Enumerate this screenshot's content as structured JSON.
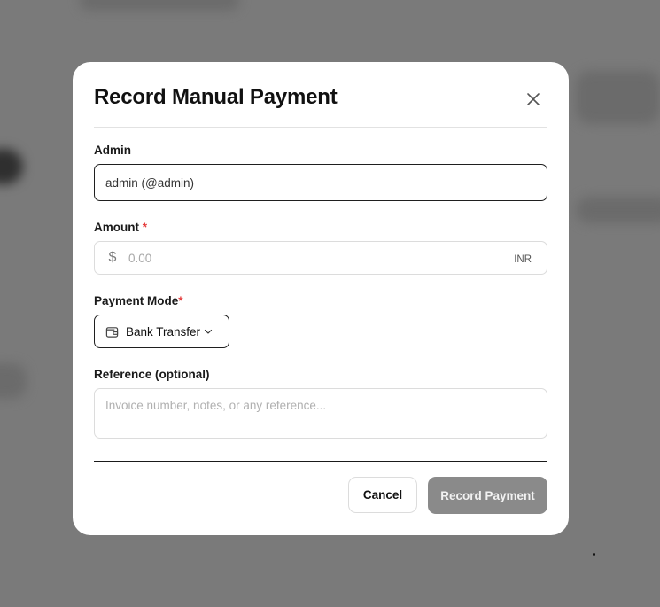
{
  "modal": {
    "title": "Record Manual Payment"
  },
  "admin_field": {
    "label": "Admin",
    "value": "admin (@admin)"
  },
  "amount_field": {
    "label": "Amount",
    "required_mark": "*",
    "currency_symbol": "$",
    "placeholder": "0.00",
    "currency": "INR"
  },
  "payment_mode": {
    "label": "Payment Mode",
    "required_mark": "*",
    "selected": "Bank Transfer",
    "icon": "wallet-icon"
  },
  "reference_field": {
    "label": "Reference (optional)",
    "placeholder": "Invoice number, notes, or any reference..."
  },
  "actions": {
    "cancel_label": "Cancel",
    "submit_label": "Record Payment"
  },
  "colors": {
    "required": "#e53e3e",
    "submit_disabled_bg": "#8a8a8a",
    "overlay": "#7a7a7a"
  }
}
